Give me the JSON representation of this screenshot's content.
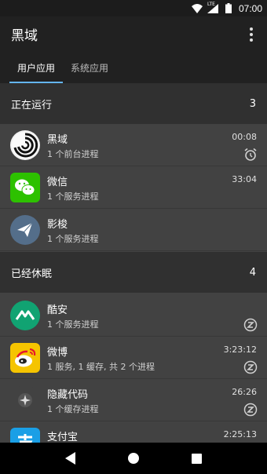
{
  "status_bar": {
    "time": "07:00",
    "network_label": "LTE"
  },
  "app_bar": {
    "title": "黑域"
  },
  "tabs": [
    {
      "label": "用户应用",
      "active": true
    },
    {
      "label": "系统应用",
      "active": false
    }
  ],
  "sections": {
    "running": {
      "title": "正在运行",
      "count": "3"
    },
    "sleeping": {
      "title": "已经休眠",
      "count": "4"
    }
  },
  "running_apps": [
    {
      "name": "黑域",
      "desc": "1 个前台进程",
      "time": "00:08",
      "icon": "brevent-icon",
      "state_icon": "alarm-icon"
    },
    {
      "name": "微信",
      "desc": "1 个服务进程",
      "time": "33:04",
      "icon": "wechat-icon",
      "state_icon": ""
    },
    {
      "name": "影梭",
      "desc": "1 个服务进程",
      "time": "",
      "icon": "shadowsocks-icon",
      "state_icon": ""
    }
  ],
  "sleeping_apps": [
    {
      "name": "酷安",
      "desc": "1 个服务进程",
      "time": "",
      "icon": "coolapk-icon",
      "state_icon": "sleep-icon"
    },
    {
      "name": "微博",
      "desc": "1 服务, 1 缓存, 共 2 个进程",
      "time": "3:23:12",
      "icon": "weibo-icon",
      "state_icon": "sleep-icon"
    },
    {
      "name": "隐藏代码",
      "desc": "1 个缓存进程",
      "time": "26:26",
      "icon": "hidden-code-icon",
      "state_icon": "sleep-icon"
    },
    {
      "name": "支付宝",
      "desc": "",
      "time": "2:25:13",
      "icon": "alipay-icon",
      "state_icon": ""
    }
  ],
  "colors": {
    "accent": "#64b5f6",
    "wechat": "#2dc100",
    "coolapk": "#11a372",
    "alipay": "#1a9fe6"
  }
}
